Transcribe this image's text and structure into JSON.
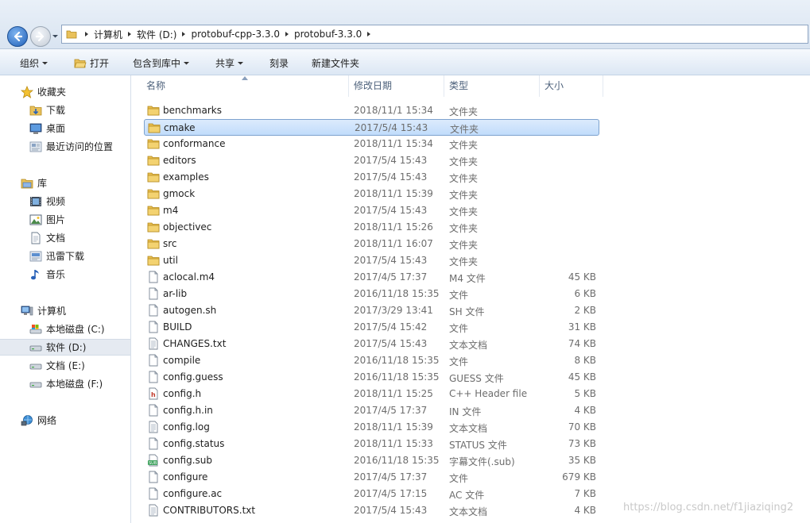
{
  "address": {
    "crumbs": [
      "计算机",
      "软件 (D:)",
      "protobuf-cpp-3.3.0",
      "protobuf-3.3.0"
    ]
  },
  "toolbar": {
    "organize": "组织",
    "open": "打开",
    "include_in_library": "包含到库中",
    "share": "共享",
    "burn": "刻录",
    "new_folder": "新建文件夹"
  },
  "nav": {
    "favorites": "收藏夹",
    "downloads": "下载",
    "desktop": "桌面",
    "recent": "最近访问的位置",
    "libraries": "库",
    "videos": "视频",
    "pictures": "图片",
    "documents": "文档",
    "thunder": "迅雷下载",
    "music": "音乐",
    "computer": "计算机",
    "drive_c": "本地磁盘 (C:)",
    "drive_d": "软件 (D:)",
    "drive_e": "文档 (E:)",
    "drive_f": "本地磁盘 (F:)",
    "network": "网络"
  },
  "columns": {
    "name": "名称",
    "date": "修改日期",
    "type": "类型",
    "size": "大小"
  },
  "files": [
    {
      "name": "benchmarks",
      "date": "2018/11/1 15:34",
      "type": "文件夹",
      "size": "",
      "icon": "folder-icon"
    },
    {
      "name": "cmake",
      "date": "2017/5/4 15:43",
      "type": "文件夹",
      "size": "",
      "icon": "folder-icon"
    },
    {
      "name": "conformance",
      "date": "2018/11/1 15:34",
      "type": "文件夹",
      "size": "",
      "icon": "folder-icon"
    },
    {
      "name": "editors",
      "date": "2017/5/4 15:43",
      "type": "文件夹",
      "size": "",
      "icon": "folder-icon"
    },
    {
      "name": "examples",
      "date": "2017/5/4 15:43",
      "type": "文件夹",
      "size": "",
      "icon": "folder-icon"
    },
    {
      "name": "gmock",
      "date": "2018/11/1 15:39",
      "type": "文件夹",
      "size": "",
      "icon": "folder-icon"
    },
    {
      "name": "m4",
      "date": "2017/5/4 15:43",
      "type": "文件夹",
      "size": "",
      "icon": "folder-icon"
    },
    {
      "name": "objectivec",
      "date": "2018/11/1 15:26",
      "type": "文件夹",
      "size": "",
      "icon": "folder-icon"
    },
    {
      "name": "src",
      "date": "2018/11/1 16:07",
      "type": "文件夹",
      "size": "",
      "icon": "folder-icon"
    },
    {
      "name": "util",
      "date": "2017/5/4 15:43",
      "type": "文件夹",
      "size": "",
      "icon": "folder-icon"
    },
    {
      "name": "aclocal.m4",
      "date": "2017/4/5 17:37",
      "type": "M4 文件",
      "size": "45 KB",
      "icon": "file-icon"
    },
    {
      "name": "ar-lib",
      "date": "2016/11/18 15:35",
      "type": "文件",
      "size": "6 KB",
      "icon": "file-icon"
    },
    {
      "name": "autogen.sh",
      "date": "2017/3/29 13:41",
      "type": "SH 文件",
      "size": "2 KB",
      "icon": "file-icon"
    },
    {
      "name": "BUILD",
      "date": "2017/5/4 15:42",
      "type": "文件",
      "size": "31 KB",
      "icon": "file-icon"
    },
    {
      "name": "CHANGES.txt",
      "date": "2017/5/4 15:43",
      "type": "文本文档",
      "size": "74 KB",
      "icon": "text-file-icon"
    },
    {
      "name": "compile",
      "date": "2016/11/18 15:35",
      "type": "文件",
      "size": "8 KB",
      "icon": "file-icon"
    },
    {
      "name": "config.guess",
      "date": "2016/11/18 15:35",
      "type": "GUESS 文件",
      "size": "45 KB",
      "icon": "file-icon"
    },
    {
      "name": "config.h",
      "date": "2018/11/1 15:25",
      "type": "C++ Header file",
      "size": "5 KB",
      "icon": "header-file-icon"
    },
    {
      "name": "config.h.in",
      "date": "2017/4/5 17:37",
      "type": "IN 文件",
      "size": "4 KB",
      "icon": "file-icon"
    },
    {
      "name": "config.log",
      "date": "2018/11/1 15:39",
      "type": "文本文档",
      "size": "70 KB",
      "icon": "text-file-icon"
    },
    {
      "name": "config.status",
      "date": "2018/11/1 15:33",
      "type": "STATUS 文件",
      "size": "73 KB",
      "icon": "file-icon"
    },
    {
      "name": "config.sub",
      "date": "2016/11/18 15:35",
      "type": "字幕文件(.sub)",
      "size": "35 KB",
      "icon": "subtitle-file-icon"
    },
    {
      "name": "configure",
      "date": "2017/4/5 17:37",
      "type": "文件",
      "size": "679 KB",
      "icon": "file-icon"
    },
    {
      "name": "configure.ac",
      "date": "2017/4/5 17:15",
      "type": "AC 文件",
      "size": "7 KB",
      "icon": "file-icon"
    },
    {
      "name": "CONTRIBUTORS.txt",
      "date": "2017/5/4 15:43",
      "type": "文本文档",
      "size": "4 KB",
      "icon": "text-file-icon"
    }
  ],
  "selected_file": "cmake",
  "watermark": "https://blog.csdn.net/f1jiaziqing2"
}
